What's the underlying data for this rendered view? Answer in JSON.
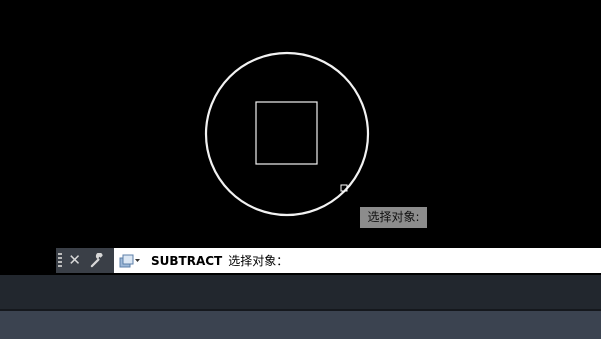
{
  "canvas": {
    "background_color": "#000000",
    "geometry": [
      "circle",
      "square"
    ],
    "cursor": "pickbox"
  },
  "tooltip": {
    "text": "选择对象:"
  },
  "command_line": {
    "grip_icon": "grip-icon",
    "close_icon": "close-icon",
    "customize_icon": "wrench-icon",
    "recent_commands_icon": "recent-commands-icon",
    "command": "SUBTRACT",
    "prompt": "选择对象："
  },
  "colors": {
    "canvas": "#000000",
    "command_bar_bg": "#3a3f47",
    "status_band": "#22272e",
    "status_band_lower": "#3b4350"
  }
}
